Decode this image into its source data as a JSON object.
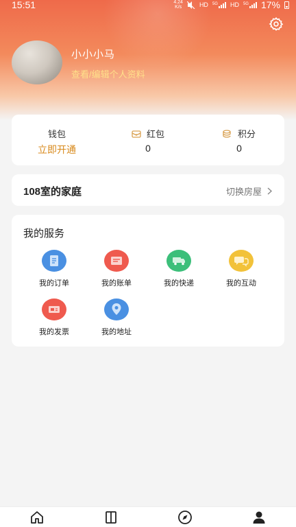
{
  "status_bar": {
    "time": "15:51",
    "speed_value": "4.24",
    "speed_unit": "K/s",
    "network_1": "HD",
    "network_2": "HD",
    "gen_1": "5G",
    "gen_2": "5G",
    "battery": "17%"
  },
  "profile": {
    "username": "小小小马",
    "edit_link": "查看/编辑个人资料"
  },
  "wallet": {
    "columns": [
      {
        "label": "钱包",
        "value": "立即开通"
      },
      {
        "label": "红包",
        "value": "0"
      },
      {
        "label": "积分",
        "value": "0"
      }
    ]
  },
  "house": {
    "title": "108室的家庭",
    "switch_label": "切换房屋"
  },
  "services": {
    "title": "我的服务",
    "items": [
      {
        "label": "我的订单",
        "icon": "order-icon",
        "color": "#4a90e2"
      },
      {
        "label": "我的账单",
        "icon": "bill-icon",
        "color": "#ef5a4e"
      },
      {
        "label": "我的快递",
        "icon": "delivery-truck-icon",
        "color": "#3cbf7a"
      },
      {
        "label": "我的互动",
        "icon": "chat-bubbles-icon",
        "color": "#f2c23a"
      },
      {
        "label": "我的发票",
        "icon": "invoice-icon",
        "color": "#ef5a4e"
      },
      {
        "label": "我的地址",
        "icon": "location-pin-icon",
        "color": "#4a90e2"
      }
    ]
  },
  "tabbar": {
    "tabs": [
      {
        "icon": "home-icon"
      },
      {
        "icon": "book-icon"
      },
      {
        "icon": "compass-icon"
      },
      {
        "icon": "profile-icon",
        "active": true
      }
    ]
  },
  "colors": {
    "header_top": "#ef6a4a",
    "accent_gold": "#d88a1c",
    "edit_link": "#ffe08a"
  }
}
